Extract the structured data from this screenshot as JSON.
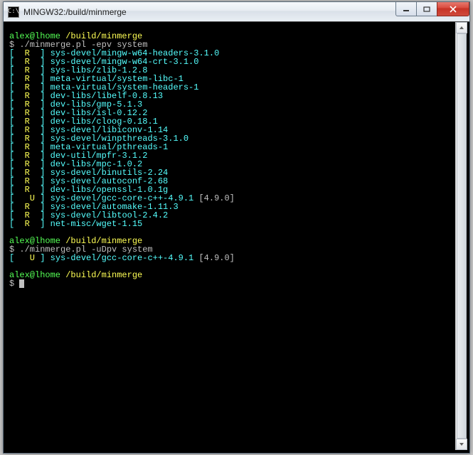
{
  "window": {
    "title": "MINGW32:/build/minmerge",
    "icon_glyph": "C:\\"
  },
  "prompt1": {
    "user_host": "alex@lhome",
    "path": "/build/minmerge",
    "command": "./minmerge.pl -epv system"
  },
  "list1": [
    {
      "flag": "R",
      "pkg": "sys-devel/mingw-w64-headers-3.1.0",
      "extra": ""
    },
    {
      "flag": "R",
      "pkg": "sys-devel/mingw-w64-crt-3.1.0",
      "extra": ""
    },
    {
      "flag": "R",
      "pkg": "sys-libs/zlib-1.2.8",
      "extra": ""
    },
    {
      "flag": "R",
      "pkg": "meta-virtual/system-libc-1",
      "extra": ""
    },
    {
      "flag": "R",
      "pkg": "meta-virtual/system-headers-1",
      "extra": ""
    },
    {
      "flag": "R",
      "pkg": "dev-libs/libelf-0.8.13",
      "extra": ""
    },
    {
      "flag": "R",
      "pkg": "dev-libs/gmp-5.1.3",
      "extra": ""
    },
    {
      "flag": "R",
      "pkg": "dev-libs/isl-0.12.2",
      "extra": ""
    },
    {
      "flag": "R",
      "pkg": "dev-libs/cloog-0.18.1",
      "extra": ""
    },
    {
      "flag": "R",
      "pkg": "sys-devel/libiconv-1.14",
      "extra": ""
    },
    {
      "flag": "R",
      "pkg": "sys-devel/winpthreads-3.1.0",
      "extra": ""
    },
    {
      "flag": "R",
      "pkg": "meta-virtual/pthreads-1",
      "extra": ""
    },
    {
      "flag": "R",
      "pkg": "dev-util/mpfr-3.1.2",
      "extra": ""
    },
    {
      "flag": "R",
      "pkg": "dev-libs/mpc-1.0.2",
      "extra": ""
    },
    {
      "flag": "R",
      "pkg": "sys-devel/binutils-2.24",
      "extra": ""
    },
    {
      "flag": "R",
      "pkg": "sys-devel/autoconf-2.68",
      "extra": ""
    },
    {
      "flag": "R",
      "pkg": "dev-libs/openssl-1.0.1g",
      "extra": ""
    },
    {
      "flag": "U",
      "pkg": "sys-devel/gcc-core-c++-4.9.1",
      "extra": "[4.9.0]"
    },
    {
      "flag": "R",
      "pkg": "sys-devel/automake-1.11.3",
      "extra": ""
    },
    {
      "flag": "R",
      "pkg": "sys-devel/libtool-2.4.2",
      "extra": ""
    },
    {
      "flag": "R",
      "pkg": "net-misc/wget-1.15",
      "extra": ""
    }
  ],
  "prompt2": {
    "user_host": "alex@lhome",
    "path": "/build/minmerge",
    "command": "./minmerge.pl -uDpv system"
  },
  "list2": [
    {
      "flag": "U",
      "pkg": "sys-devel/gcc-core-c++-4.9.1",
      "extra": "[4.9.0]"
    }
  ],
  "prompt3": {
    "user_host": "alex@lhome",
    "path": "/build/minmerge",
    "command": ""
  }
}
